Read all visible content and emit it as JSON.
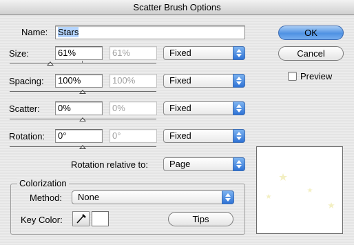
{
  "window": {
    "title": "Scatter Brush Options"
  },
  "name": {
    "label": "Name:",
    "value": "Stars"
  },
  "size": {
    "label": "Size:",
    "value": "61%",
    "value2": "61%",
    "mode": "Fixed"
  },
  "spacing": {
    "label": "Spacing:",
    "value": "100%",
    "value2": "100%",
    "mode": "Fixed"
  },
  "scatter": {
    "label": "Scatter:",
    "value": "0%",
    "value2": "0%",
    "mode": "Fixed"
  },
  "rotation": {
    "label": "Rotation:",
    "value": "0°",
    "value2": "0°",
    "mode": "Fixed"
  },
  "rotation_relative": {
    "label": "Rotation relative to:",
    "value": "Page"
  },
  "buttons": {
    "ok": "OK",
    "cancel": "Cancel",
    "preview": "Preview",
    "tips": "Tips"
  },
  "colorization": {
    "title": "Colorization",
    "method_label": "Method:",
    "method_value": "None",
    "key_color_label": "Key Color:"
  },
  "icons": {
    "popup": "popup-arrows-icon",
    "eyedropper": "eyedropper-icon",
    "star": "star-icon"
  },
  "colors": {
    "accent": "#4f92e3",
    "star": "#f3efc2",
    "selection": "#b5d5ff"
  }
}
